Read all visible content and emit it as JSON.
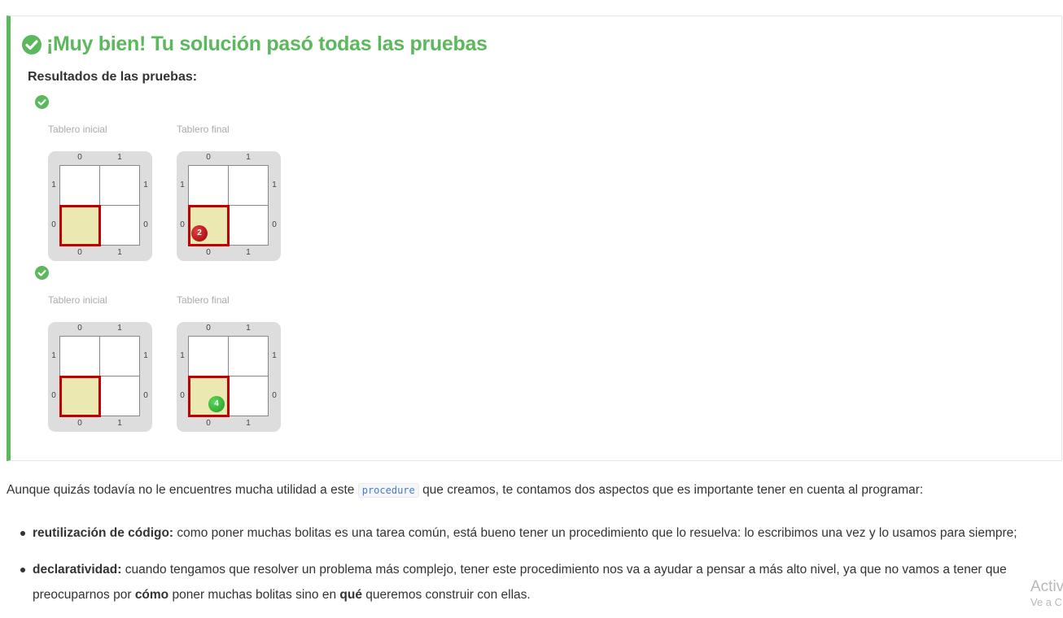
{
  "result": {
    "title": "¡Muy bien! Tu solución pasó todas las pruebas",
    "tests_label": "Resultados de las pruebas:",
    "accent_color": "#5cb85c",
    "tests": [
      {
        "status": "passed",
        "initial": {
          "caption": "Tablero inicial",
          "columns": [
            "0",
            "1"
          ],
          "rows": [
            "1",
            "0"
          ],
          "head": "0,0"
        },
        "final": {
          "caption": "Tablero final",
          "columns": [
            "0",
            "1"
          ],
          "rows": [
            "1",
            "0"
          ],
          "head": "0,0",
          "ball": {
            "color": "red",
            "count": "2"
          }
        }
      },
      {
        "status": "passed",
        "initial": {
          "caption": "Tablero inicial",
          "columns": [
            "0",
            "1"
          ],
          "rows": [
            "1",
            "0"
          ],
          "head": "0,0"
        },
        "final": {
          "caption": "Tablero final",
          "columns": [
            "0",
            "1"
          ],
          "rows": [
            "1",
            "0"
          ],
          "head": "0,0",
          "ball": {
            "color": "green",
            "count": "4"
          }
        }
      }
    ]
  },
  "explanation": {
    "intro_before": "Aunque quizás todavía no le encuentres mucha utilidad a este",
    "intro_code": "procedure",
    "intro_after": "que creamos, te contamos dos aspectos que es importante tener en cuenta al programar:",
    "item1_bold": "reutilización de código:",
    "item1_text": "como poner muchas bolitas es una tarea común, está bueno tener un procedimiento que lo resuelva: lo escribimos una vez y lo usamos para siempre;",
    "item2_bold": "declaratividad:",
    "item2_text_a": "cuando tengamos que resolver un problema más complejo, tener este procedimiento nos va a ayudar a pensar a más alto nivel, ya que no vamos a tener que preocuparnos por",
    "item2_bold_como": "cómo",
    "item2_text_b": "poner muchas bolitas sino en",
    "item2_bold_que": "qué",
    "item2_text_c": "queremos construir con ellas."
  },
  "watermark": {
    "line1": "Activ",
    "line2": "Ve a C"
  }
}
